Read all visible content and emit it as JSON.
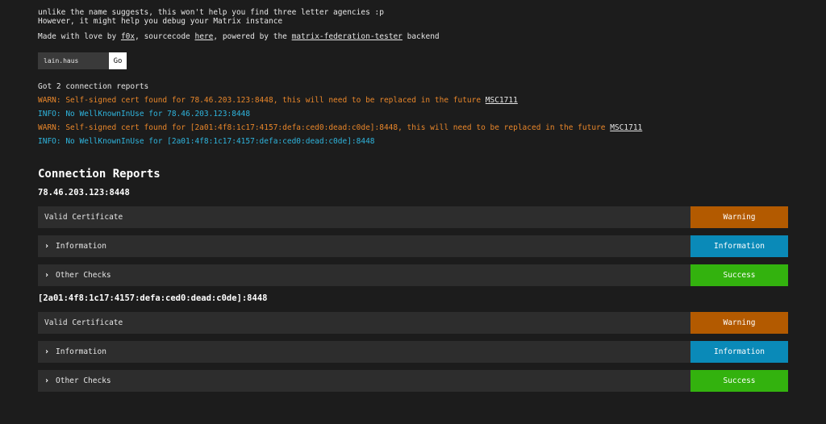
{
  "intro": {
    "line1": "unlike the name suggests, this won't help you find three letter agencies :p",
    "line2": "However, it might help you debug your Matrix instance",
    "credits_prefix": "Made with love by ",
    "credits_author": "f0x",
    "credits_mid": ", sourcecode ",
    "credits_source": "here",
    "credits_mid2": ", powered by the ",
    "credits_backend": "matrix-federation-tester",
    "credits_suffix": " backend"
  },
  "form": {
    "input_value": "lain.haus",
    "go_label": "Go"
  },
  "summary": {
    "count_text": "Got 2 connection reports",
    "messages": [
      {
        "level": "warn",
        "text": "WARN: Self-signed cert found for 78.46.203.123:8448, this will need to be replaced in the future ",
        "link": "MSC1711"
      },
      {
        "level": "info",
        "text": "INFO: No WellKnownInUse for 78.46.203.123:8448",
        "link": ""
      },
      {
        "level": "warn",
        "text": "WARN: Self-signed cert found for [2a01:4f8:1c17:4157:defa:ced0:dead:c0de]:8448, this will need to be replaced in the future ",
        "link": "MSC1711"
      },
      {
        "level": "info",
        "text": "INFO: No WellKnownInUse for [2a01:4f8:1c17:4157:defa:ced0:dead:c0de]:8448",
        "link": ""
      }
    ]
  },
  "reports": {
    "title": "Connection Reports",
    "hosts": [
      {
        "address": "78.46.203.123:8448",
        "rows": [
          {
            "label": "Valid Certificate",
            "status": "Warning"
          },
          {
            "label": "Information",
            "status": "Information"
          },
          {
            "label": "Other Checks",
            "status": "Success"
          }
        ]
      },
      {
        "address": "[2a01:4f8:1c17:4157:defa:ced0:dead:c0de]:8448",
        "rows": [
          {
            "label": "Valid Certificate",
            "status": "Warning"
          },
          {
            "label": "Information",
            "status": "Information"
          },
          {
            "label": "Other Checks",
            "status": "Success"
          }
        ]
      }
    ]
  },
  "colors": {
    "background": "#1c1c1c",
    "warn_text": "#e8862a",
    "info_text": "#2fb4dd",
    "warning_badge": "#b35a00",
    "information_badge": "#0a8ab8",
    "success_badge": "#33b20e"
  }
}
